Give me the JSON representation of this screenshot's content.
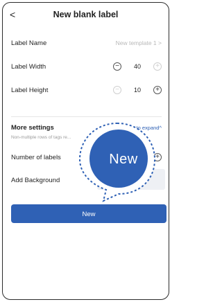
{
  "header": {
    "back_icon": "chevron-left-icon",
    "back_glyph": "<",
    "title": "New blank label"
  },
  "form": {
    "label_name": {
      "label": "Label Name",
      "value": "New template 1",
      "chevron": ">"
    },
    "label_width": {
      "label": "Label Width",
      "value": "40",
      "minus": "−",
      "plus": "+"
    },
    "label_height": {
      "label": "Label Height",
      "value": "10",
      "minus": "−",
      "plus": "+"
    }
  },
  "more_settings": {
    "title": "More settings",
    "expand_label": "to expand",
    "expand_icon_glyph": "^",
    "hint": "Non-multiple rows of tags re...",
    "number_of_labels": {
      "label": "Number of labels",
      "plus": "+"
    },
    "add_background": {
      "label": "Add Background"
    }
  },
  "callout": {
    "label": "New"
  },
  "new_button": {
    "label": "New"
  },
  "colors": {
    "accent": "#2f61b5",
    "callout": "#2f61b5"
  }
}
